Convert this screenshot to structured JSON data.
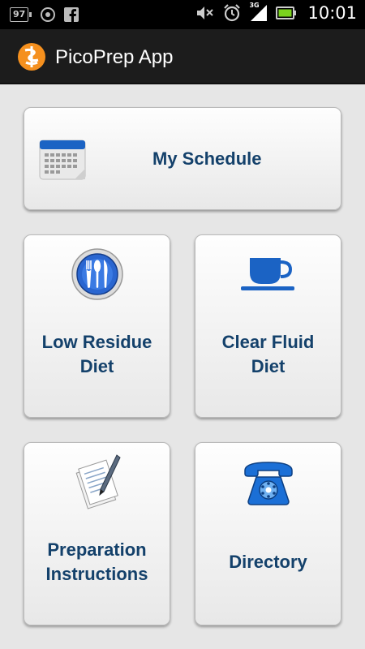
{
  "status_bar": {
    "battery_badge": "97",
    "time": "10:01",
    "network_type": "3G"
  },
  "action_bar": {
    "title": "PicoPrep App"
  },
  "tiles": {
    "schedule": {
      "label": "My Schedule"
    },
    "low_residue": {
      "line1": "Low Residue",
      "line2": "Diet"
    },
    "clear_fluid": {
      "line1": "Clear Fluid",
      "line2": "Diet"
    },
    "preparation": {
      "line1": "Preparation",
      "line2": "Instructions"
    },
    "directory": {
      "label": "Directory"
    }
  },
  "colors": {
    "label_blue": "#14416b",
    "icon_blue": "#1b63c4",
    "logo_orange": "#f5901e"
  },
  "icons": {
    "schedule": "calendar-icon",
    "low_residue": "cutlery-icon",
    "clear_fluid": "cup-icon",
    "preparation": "document-pen-icon",
    "directory": "telephone-icon"
  }
}
